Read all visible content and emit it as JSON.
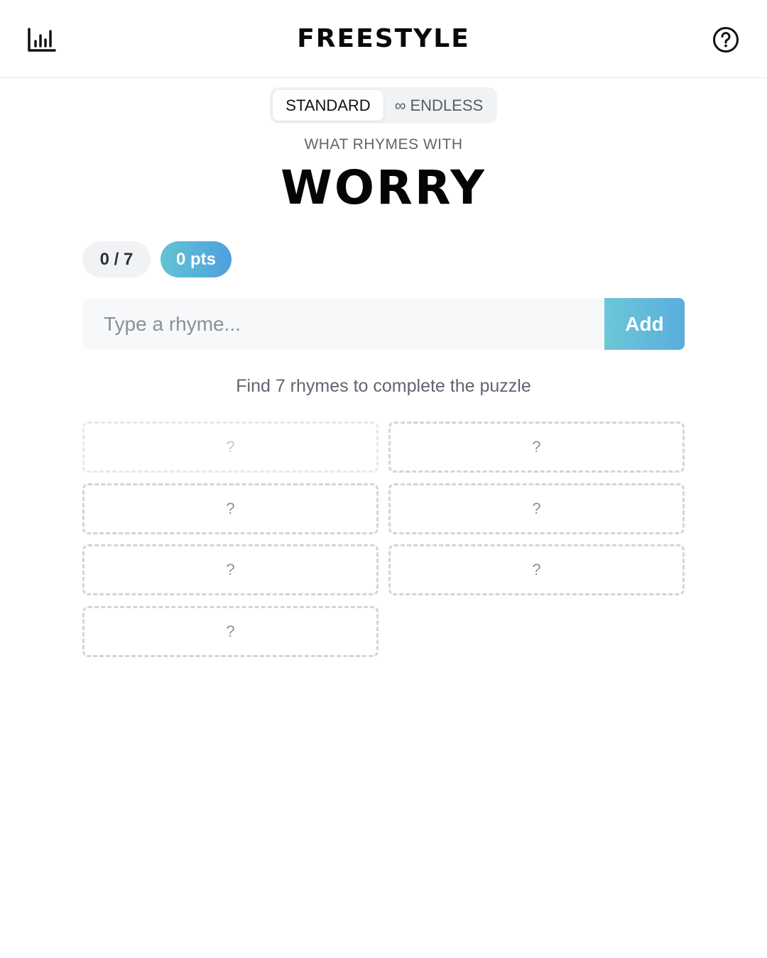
{
  "header": {
    "title": "FREESTYLE",
    "stats_icon": "bar-chart-icon",
    "help_icon": "help-circle-icon"
  },
  "mode_toggle": {
    "options": [
      {
        "label": "STANDARD",
        "selected": true
      },
      {
        "label": "ENDLESS",
        "icon": "infinity-icon",
        "icon_glyph": "∞",
        "selected": false
      }
    ]
  },
  "prompt": {
    "label": "WHAT RHYMES WITH",
    "word": "WORRY"
  },
  "score": {
    "counter": "0 / 7",
    "points": "0 pts"
  },
  "input": {
    "placeholder": "Type a rhyme...",
    "value": "",
    "add_label": "Add"
  },
  "hint": "Find 7 rhymes to complete the puzzle",
  "slots": [
    {
      "label": "?"
    },
    {
      "label": "?"
    },
    {
      "label": "?"
    },
    {
      "label": "?"
    },
    {
      "label": "?"
    },
    {
      "label": "?"
    },
    {
      "label": "?"
    }
  ],
  "colors": {
    "accent_gradient_start": "#62c4d2",
    "accent_gradient_end": "#4f9fe0",
    "toggle_bg": "#f1f2f4",
    "slot_border": "#d3d5da"
  }
}
